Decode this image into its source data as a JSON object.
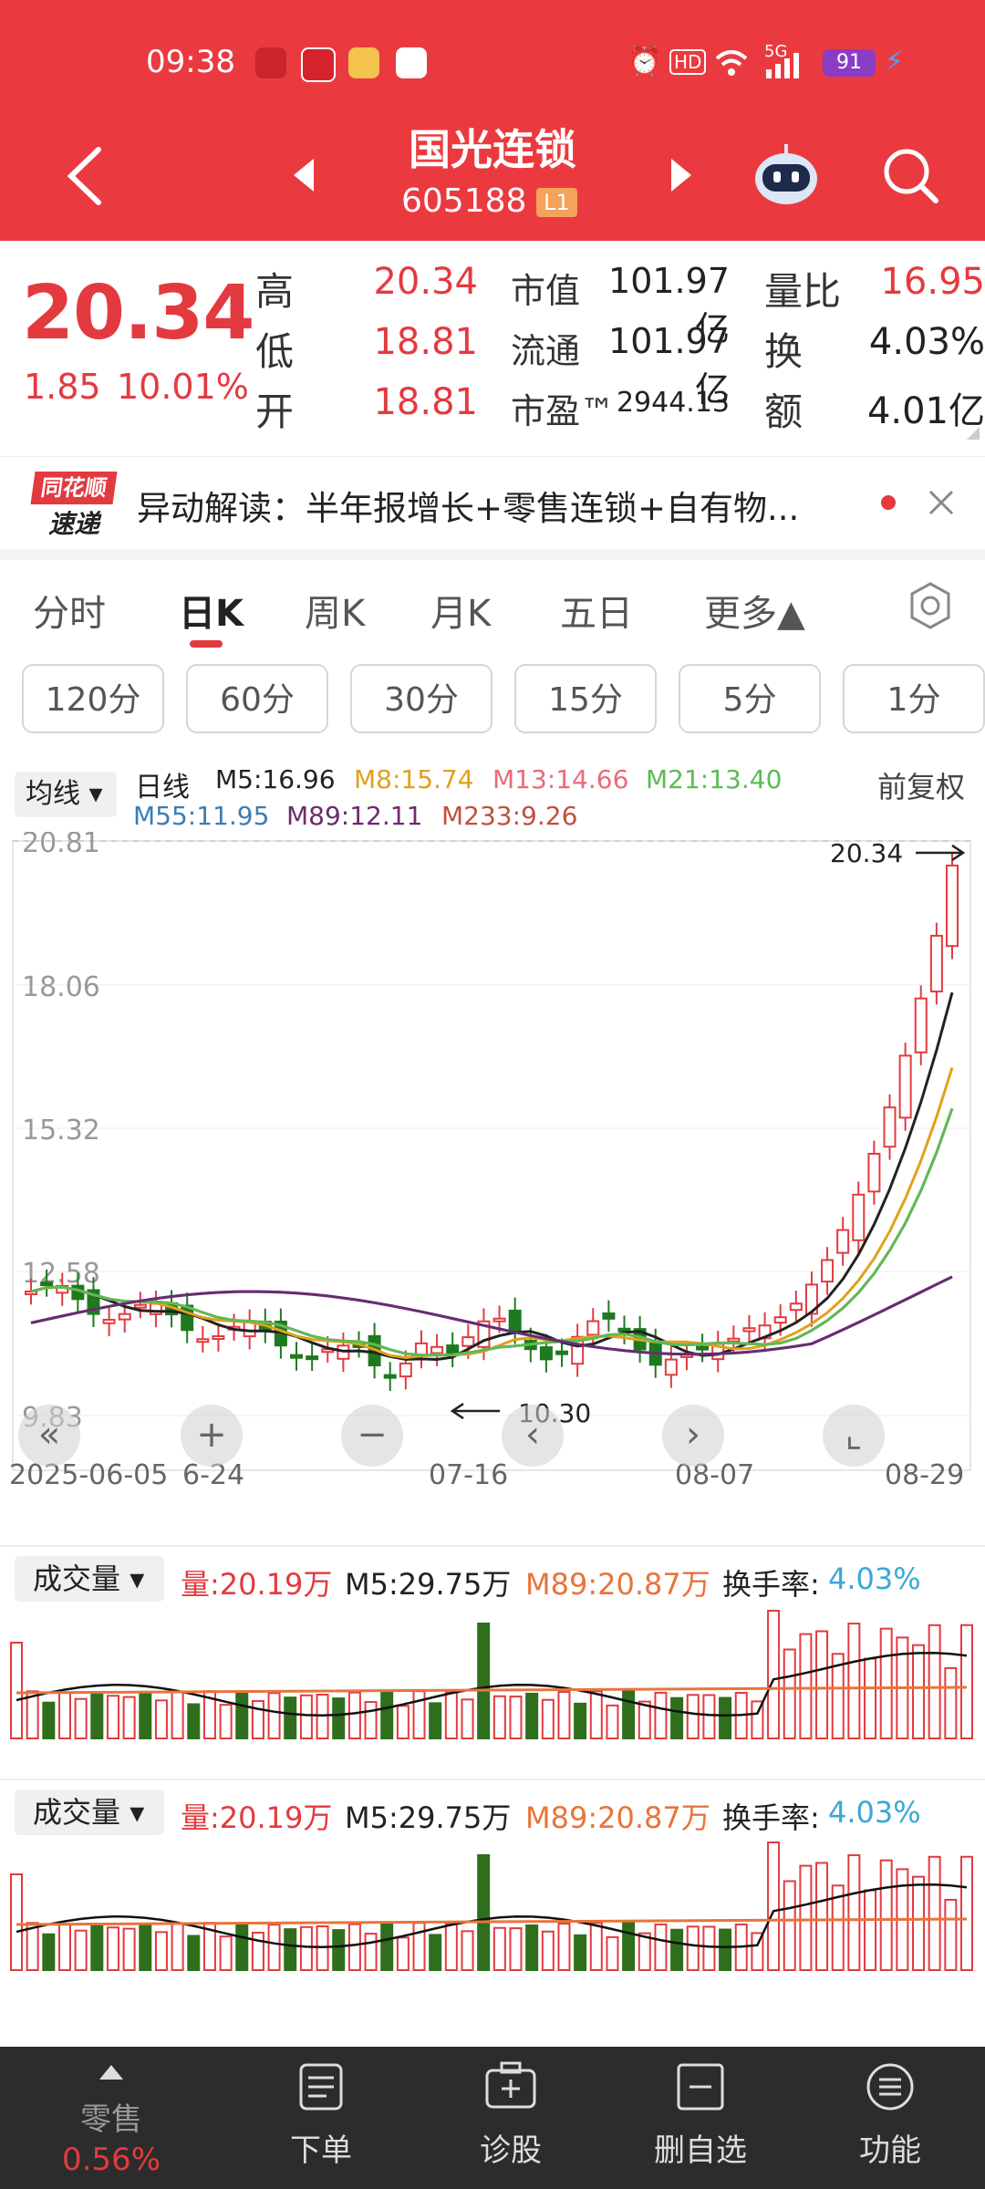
{
  "status_bar": {
    "time": "09:38",
    "signal_label": "5G",
    "battery": "91"
  },
  "header": {
    "name": "国光连锁",
    "code": "605188",
    "level": "L1"
  },
  "quote": {
    "price": "20.34",
    "change": "1.85",
    "change_pct": "10.01%",
    "rows": [
      {
        "l1": "高",
        "v1": "20.34",
        "l2": "市值",
        "v2": "101.97亿",
        "l3": "量比",
        "v3": "16.95"
      },
      {
        "l1": "低",
        "v1": "18.81",
        "l2": "流通",
        "v2": "101.97亿",
        "l3": "换",
        "v3": "4.03%"
      },
      {
        "l1": "开",
        "v1": "18.81",
        "l2": "市盈™",
        "v2": "2944.13",
        "l3": "额",
        "v3": "4.01亿"
      }
    ]
  },
  "news": {
    "logo_top": "同花顺",
    "logo_bottom": "速递",
    "text": "异动解读：半年报增长+零售连锁+自有物..."
  },
  "period_tabs": [
    "分时",
    "日K",
    "周K",
    "月K",
    "五日",
    "更多▲"
  ],
  "active_tab": "日K",
  "minute_tabs": [
    "120分",
    "60分",
    "30分",
    "15分",
    "5分",
    "1分"
  ],
  "ma_bar": {
    "selector": "均线",
    "period": "日线",
    "items": [
      {
        "label": "M5:16.96",
        "color": "#222222"
      },
      {
        "label": "M8:15.74",
        "color": "#e0a11b"
      },
      {
        "label": "M13:14.66",
        "color": "#e96b7a"
      },
      {
        "label": "M21:13.40",
        "color": "#5cbb55"
      },
      {
        "label": "M55:11.95",
        "color": "#3b7db5"
      },
      {
        "label": "M89:12.11",
        "color": "#6a2c6e"
      },
      {
        "label": "M233:9.26",
        "color": "#c0503d"
      }
    ],
    "adjust": "前复权"
  },
  "price_axis": [
    "20.81",
    "18.06",
    "15.32",
    "12.58",
    "9.83"
  ],
  "high_marker": "20.34",
  "low_marker": "10.30",
  "date_axis": [
    "2025-06-05",
    "6-24",
    "07-16",
    "08-07",
    "08-29"
  ],
  "volume_panels": [
    {
      "label": "成交量",
      "vol": "量:20.19万",
      "m5": "M5:29.75万",
      "m89": "M89:20.87万",
      "turnover_label": "换手率:",
      "turnover": "4.03%"
    },
    {
      "label": "成交量",
      "vol": "量:20.19万",
      "m5": "M5:29.75万",
      "m89": "M89:20.87万",
      "turnover_label": "换手率:",
      "turnover": "4.03%"
    }
  ],
  "bottom_nav": [
    {
      "label": "零售",
      "sub": "0.56%",
      "icon": "triangle-up-icon"
    },
    {
      "label": "下单",
      "icon": "order-icon"
    },
    {
      "label": "诊股",
      "icon": "diagnose-icon"
    },
    {
      "label": "删自选",
      "icon": "remove-watch-icon"
    },
    {
      "label": "功能",
      "icon": "menu-icon"
    }
  ],
  "chart_data": {
    "type": "candlestick",
    "x": [
      "2025-06-05",
      "6-24",
      "07-16",
      "08-07",
      "08-29"
    ],
    "ylim": [
      9.83,
      20.81
    ],
    "last_close": 20.34,
    "high": 20.34,
    "low": 10.3,
    "moving_averages": {
      "M5": 16.96,
      "M8": 15.74,
      "M13": 14.66,
      "M21": 13.4,
      "M55": 11.95,
      "M89": 12.11,
      "M233": 9.26
    },
    "volume": {
      "latest": "20.19万",
      "M5": "29.75万",
      "M89": "20.87万",
      "turnover": "4.03%"
    }
  }
}
